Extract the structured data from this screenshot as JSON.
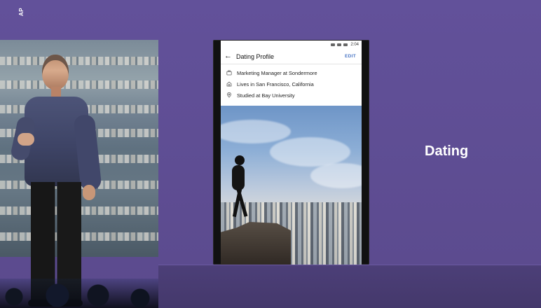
{
  "watermark": "AP",
  "phone": {
    "status_time": "2:04",
    "header_title": "Dating Profile",
    "edit_label": "EDIT",
    "details": [
      {
        "text": "Marketing Manager at Sondermore",
        "icon": "briefcase-icon"
      },
      {
        "text": "Lives in San Francisco, California",
        "icon": "home-icon"
      },
      {
        "text": "Studied at Bay University",
        "icon": "location-pin-icon"
      }
    ]
  },
  "slide": {
    "label": "Dating"
  }
}
